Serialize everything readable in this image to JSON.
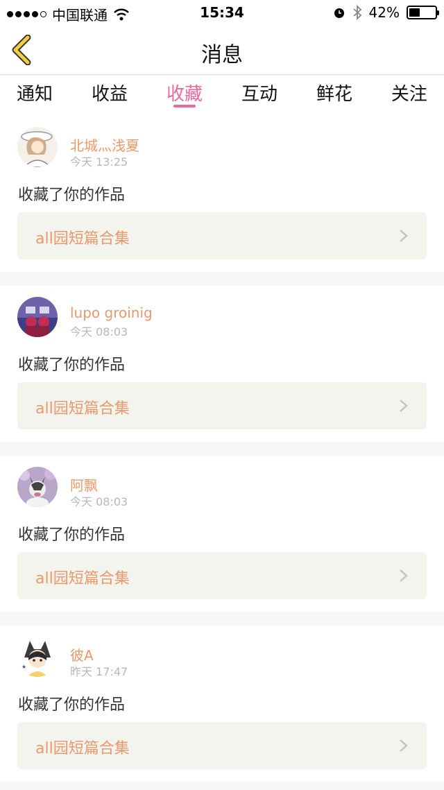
{
  "status_bar": {
    "carrier": "中国联通",
    "time": "15:34",
    "battery_text": "42%",
    "battery_level": 0.42
  },
  "nav": {
    "title": "消息"
  },
  "tabs": [
    {
      "label": "通知",
      "active": false
    },
    {
      "label": "收益",
      "active": false
    },
    {
      "label": "收藏",
      "active": true
    },
    {
      "label": "互动",
      "active": false
    },
    {
      "label": "鲜花",
      "active": false
    },
    {
      "label": "关注",
      "active": false
    }
  ],
  "feed": [
    {
      "user": "北城灬浅夏",
      "time": "今天 13:25",
      "action": "收藏了你的作品",
      "work": "all园短篇合集"
    },
    {
      "user": "lupo groinig",
      "time": "今天 08:03",
      "action": "收藏了你的作品",
      "work": "all园短篇合集"
    },
    {
      "user": "阿飘",
      "time": "今天 08:03",
      "action": "收藏了你的作品",
      "work": "all园短篇合集"
    },
    {
      "user": "彼A",
      "time": "昨天 17:47",
      "action": "收藏了你的作品",
      "work": "all园短篇合集"
    }
  ],
  "colors": {
    "accent": "#e8699b",
    "username": "#e9996b",
    "back_icon": "#f1cf3d"
  }
}
